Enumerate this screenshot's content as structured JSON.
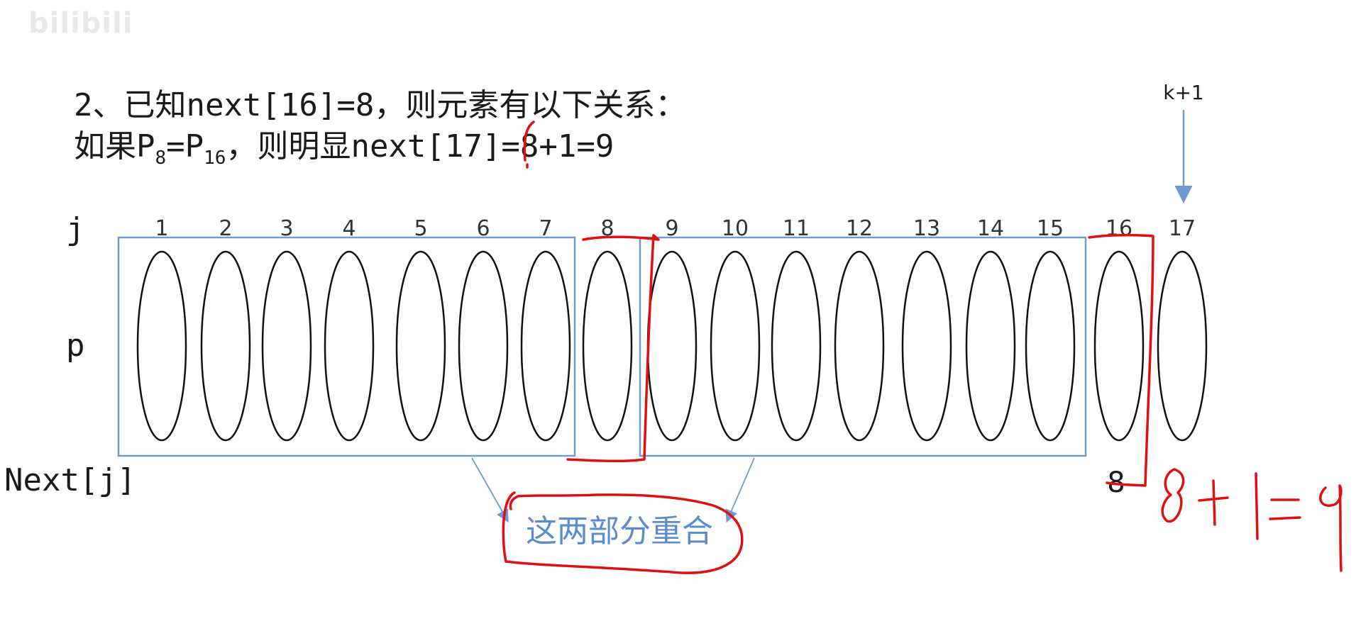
{
  "watermark": "bilibili",
  "heading": {
    "line1": "2、已知next[16]=8，则元素有以下关系：",
    "line2_prefix": "如果P",
    "line2_sub1": "8",
    "line2_mid": "=P",
    "line2_sub2": "16",
    "line2_suffix": "，则明显next[17]=8+1=9"
  },
  "row_labels": {
    "j": "j",
    "p": "p",
    "next": "Next[j]"
  },
  "indices": [
    "1",
    "2",
    "3",
    "4",
    "5",
    "6",
    "7",
    "8",
    "9",
    "10",
    "11",
    "12",
    "13",
    "14",
    "15",
    "16",
    "17"
  ],
  "arrow_label": "k+1",
  "next_value": "8",
  "overlap_note": "这两部分重合",
  "handwritten": "8+1=9",
  "colors": {
    "box": "#6f9ad0",
    "ink": "#e01010",
    "note": "#5a8ccd",
    "arrow": "#6f9ad0"
  }
}
